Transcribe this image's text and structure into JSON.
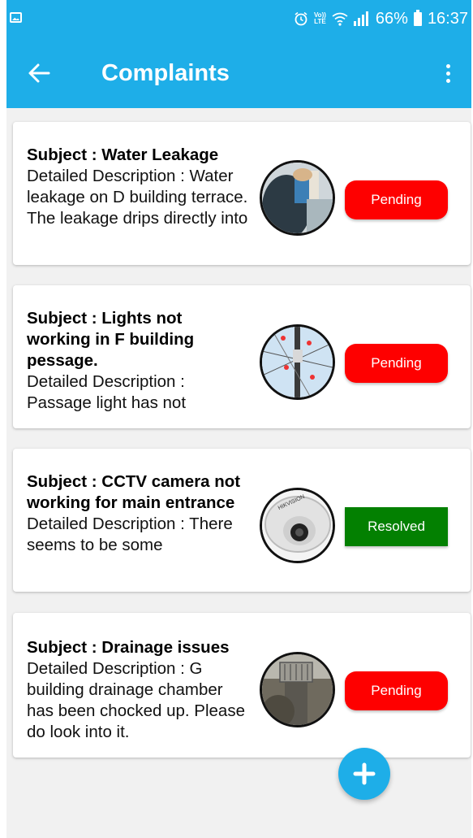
{
  "status_bar": {
    "battery": "66%",
    "time": "16:37",
    "lte_top": "Vo))",
    "lte_bottom": "LTE"
  },
  "app_bar": {
    "title": "Complaints"
  },
  "colors": {
    "primary": "#1eaee8",
    "pending": "#fe0000",
    "resolved": "#038001",
    "background": "#f1f1f1"
  },
  "complaints": [
    {
      "subject_label": "Subject :  Water Leakage",
      "description": "Detailed Description  : Water leakage on D building terrace. The leakage drips directly into",
      "status": "Pending",
      "image_icon": "water-leakage-photo"
    },
    {
      "subject_label": "Subject :  Lights not working in F building pessage.",
      "description": "Detailed Description  : Passage light has not",
      "status": "Pending",
      "image_icon": "electric-pole-photo"
    },
    {
      "subject_label": "Subject :  CCTV camera not working for main entrance",
      "description": "Detailed Description  : There seems to be some",
      "status": "Resolved",
      "image_icon": "cctv-camera-photo"
    },
    {
      "subject_label": "Subject :  Drainage issues",
      "description": "Detailed Description  :  G building drainage chamber has been chocked up. Please do look into it.",
      "status": "Pending",
      "image_icon": "drainage-photo"
    }
  ]
}
